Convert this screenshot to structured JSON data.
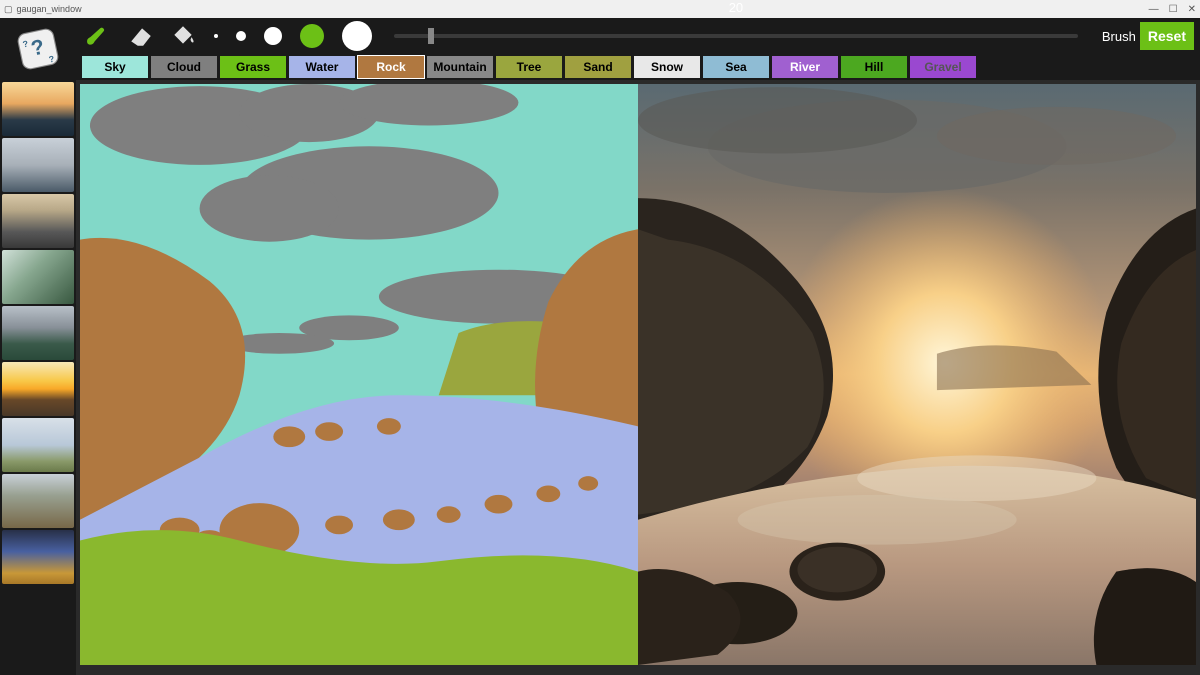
{
  "window": {
    "title": "gaugan_window"
  },
  "toolbar": {
    "brush_label": "Brush",
    "reset_label": "Reset",
    "slider_value": "20",
    "sizes": [
      4,
      10,
      18,
      24,
      30
    ],
    "selected_size_index": 3
  },
  "palette": [
    {
      "label": "Sky",
      "bg": "#9de6da",
      "fg": "#000"
    },
    {
      "label": "Cloud",
      "bg": "#7f7f7f",
      "fg": "#000"
    },
    {
      "label": "Grass",
      "bg": "#6cc016",
      "fg": "#000"
    },
    {
      "label": "Water",
      "bg": "#a6b4e8",
      "fg": "#000"
    },
    {
      "label": "Rock",
      "bg": "#b07840",
      "fg": "#fff",
      "selected": true
    },
    {
      "label": "Mountain",
      "bg": "#888888",
      "fg": "#000"
    },
    {
      "label": "Tree",
      "bg": "#9aa63e",
      "fg": "#000"
    },
    {
      "label": "Sand",
      "bg": "#a0a040",
      "fg": "#000"
    },
    {
      "label": "Snow",
      "bg": "#e8e8e8",
      "fg": "#000"
    },
    {
      "label": "Sea",
      "bg": "#8fbcd4",
      "fg": "#000"
    },
    {
      "label": "River",
      "bg": "#a060d0",
      "fg": "#fff"
    },
    {
      "label": "Hill",
      "bg": "#4ca820",
      "fg": "#000"
    },
    {
      "label": "Gravel",
      "bg": "#9a48d0",
      "fg": "#555"
    }
  ],
  "thumbnails": [
    "linear-gradient(to bottom,#f8d898 0%,#e8a860 40%,#2a3a48 70%,#1a2a38 100%)",
    "linear-gradient(to bottom,#c8d0d8 0%,#a8b0b8 50%,#4a5a68 100%)",
    "linear-gradient(to bottom,#d8c8a8 0%,#b8a888 30%,#585858 70%,#383838 100%)",
    "linear-gradient(135deg,#d0e0d8 0%,#88a890 40%,#385840 100%)",
    "linear-gradient(to bottom,#b8c0c8 0%,#889098 40%,#3a5a4a 70%,#2a4a3a 100%)",
    "linear-gradient(to bottom,#f8e8b8 0%,#f8c848 35%,#f8a828 50%,#684828 70%,#483828 100%)",
    "linear-gradient(to bottom,#d8e0e8 0%,#b8c8d8 50%,#8a9a6a 80%,#6a7a4a 100%)",
    "linear-gradient(to bottom,#c8d0d8 0%,#98a090 40%,#786848 100%)",
    "linear-gradient(to bottom,#283048 0%,#4860a0 40%,#c89838 80%,#a87828 100%)"
  ]
}
